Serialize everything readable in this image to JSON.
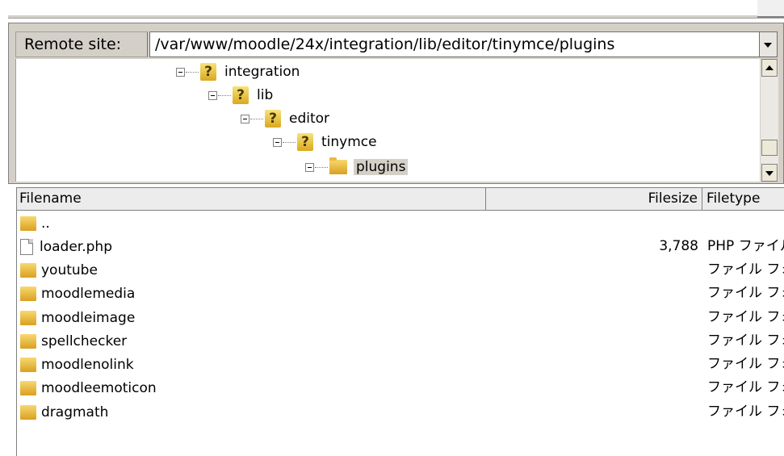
{
  "remote": {
    "label": "Remote site:",
    "path": "/var/www/moodle/24x/integration/lib/editor/tinymce/plugins"
  },
  "tree": [
    {
      "label": "integration",
      "icon": "question-folder-icon"
    },
    {
      "label": "lib",
      "icon": "question-folder-icon"
    },
    {
      "label": "editor",
      "icon": "question-folder-icon"
    },
    {
      "label": "tinymce",
      "icon": "question-folder-icon"
    },
    {
      "label": "plugins",
      "icon": "folder-icon",
      "selected": true
    }
  ],
  "columns": {
    "filename": "Filename",
    "filesize": "Filesize",
    "filetype": "Filetype"
  },
  "files": [
    {
      "name": "..",
      "size": "",
      "type": "",
      "icon": "folder-icon"
    },
    {
      "name": "loader.php",
      "size": "3,788",
      "type": "PHP ファイル",
      "icon": "document-icon"
    },
    {
      "name": "youtube",
      "size": "",
      "type": "ファイル フォルダ",
      "icon": "folder-icon"
    },
    {
      "name": "moodlemedia",
      "size": "",
      "type": "ファイル フォルダ",
      "icon": "folder-icon"
    },
    {
      "name": "moodleimage",
      "size": "",
      "type": "ファイル フォルダ",
      "icon": "folder-icon"
    },
    {
      "name": "spellchecker",
      "size": "",
      "type": "ファイル フォルダ",
      "icon": "folder-icon"
    },
    {
      "name": "moodlenolink",
      "size": "",
      "type": "ファイル フォルダ",
      "icon": "folder-icon"
    },
    {
      "name": "moodleemoticon",
      "size": "",
      "type": "ファイル フォルダ",
      "icon": "folder-icon"
    },
    {
      "name": "dragmath",
      "size": "",
      "type": "ファイル フォルダ",
      "icon": "folder-icon"
    }
  ]
}
